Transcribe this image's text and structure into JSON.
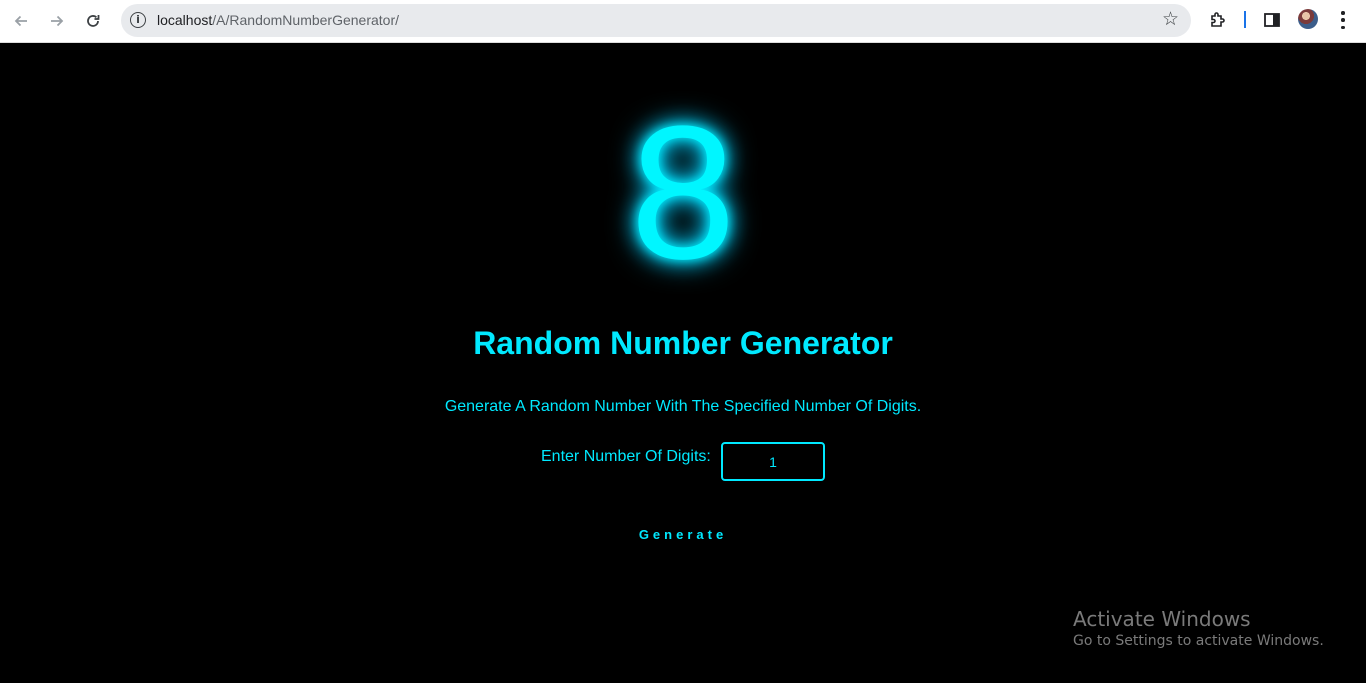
{
  "browser": {
    "url_host": "localhost",
    "url_path": "/A/RandomNumberGenerator/",
    "back_icon": "arrow-left-icon",
    "forward_icon": "arrow-right-icon",
    "reload_icon": "reload-icon",
    "info_icon": "info-icon",
    "bookmark_icon": "star-icon",
    "extensions_icon": "puzzle-icon",
    "side_panel_icon": "side-panel-icon",
    "menu_icon": "kebab-menu-icon"
  },
  "app": {
    "display_digit": "8",
    "title": "Random Number Generator",
    "subtitle": "Generate A Random Number With The Specified Number Of Digits.",
    "digits_label": "Enter Number Of Digits:",
    "digits_value": "1",
    "generate_label": "Generate",
    "accent_color": "#00e9ff"
  },
  "watermark": {
    "title": "Activate Windows",
    "subtitle": "Go to Settings to activate Windows."
  }
}
